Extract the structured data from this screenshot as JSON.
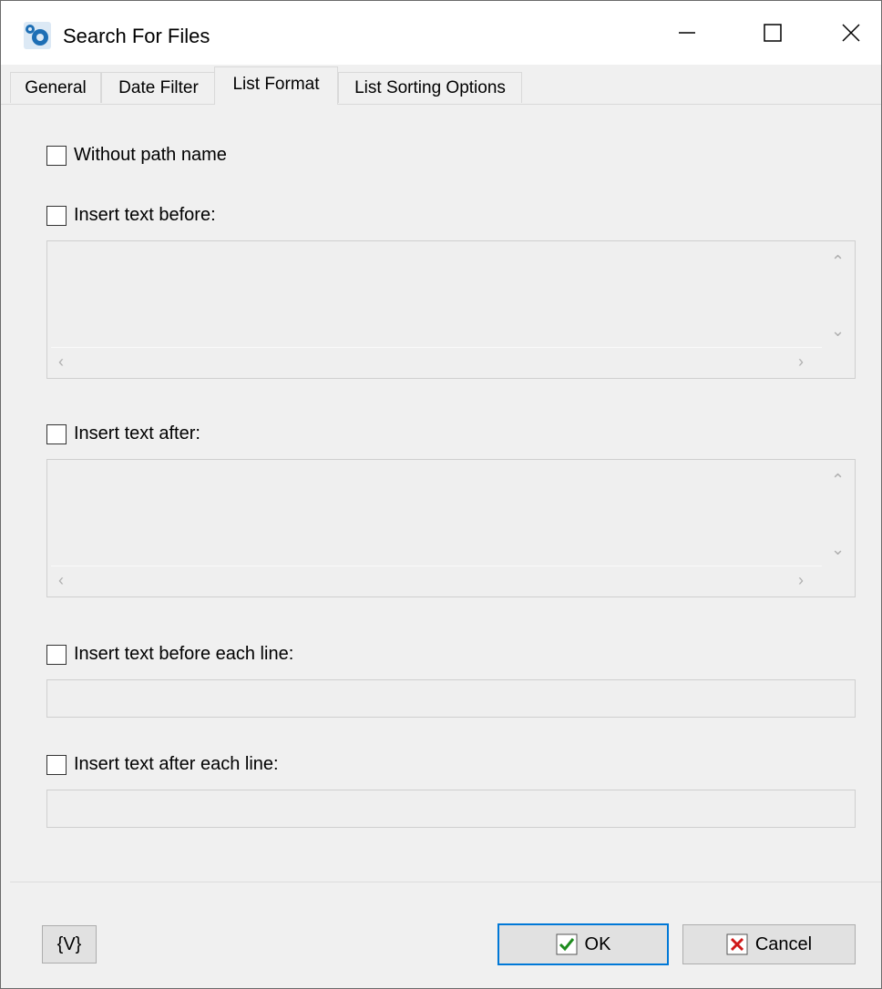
{
  "window": {
    "title": "Search For Files",
    "controls": {
      "minimize": "minimize-icon",
      "maximize": "maximize-icon",
      "close": "close-icon"
    }
  },
  "tabs": [
    {
      "label": "General",
      "active": false
    },
    {
      "label": "Date Filter",
      "active": false
    },
    {
      "label": "List Format",
      "active": true
    },
    {
      "label": "List Sorting Options",
      "active": false
    }
  ],
  "options": {
    "without_path": {
      "label": "Without path name",
      "checked": false
    },
    "insert_before": {
      "label": "Insert text before:",
      "checked": false,
      "value": ""
    },
    "insert_after": {
      "label": "Insert text after:",
      "checked": false,
      "value": ""
    },
    "insert_before_each": {
      "label": "Insert text before each line:",
      "checked": false,
      "value": ""
    },
    "insert_after_each": {
      "label": "Insert text after each line:",
      "checked": false,
      "value": ""
    }
  },
  "buttons": {
    "variables": "{V}",
    "ok": "OK",
    "cancel": "Cancel"
  },
  "colors": {
    "accent": "#0078d7",
    "ok_check": "#1e8c1e",
    "cancel_x": "#d01818"
  }
}
